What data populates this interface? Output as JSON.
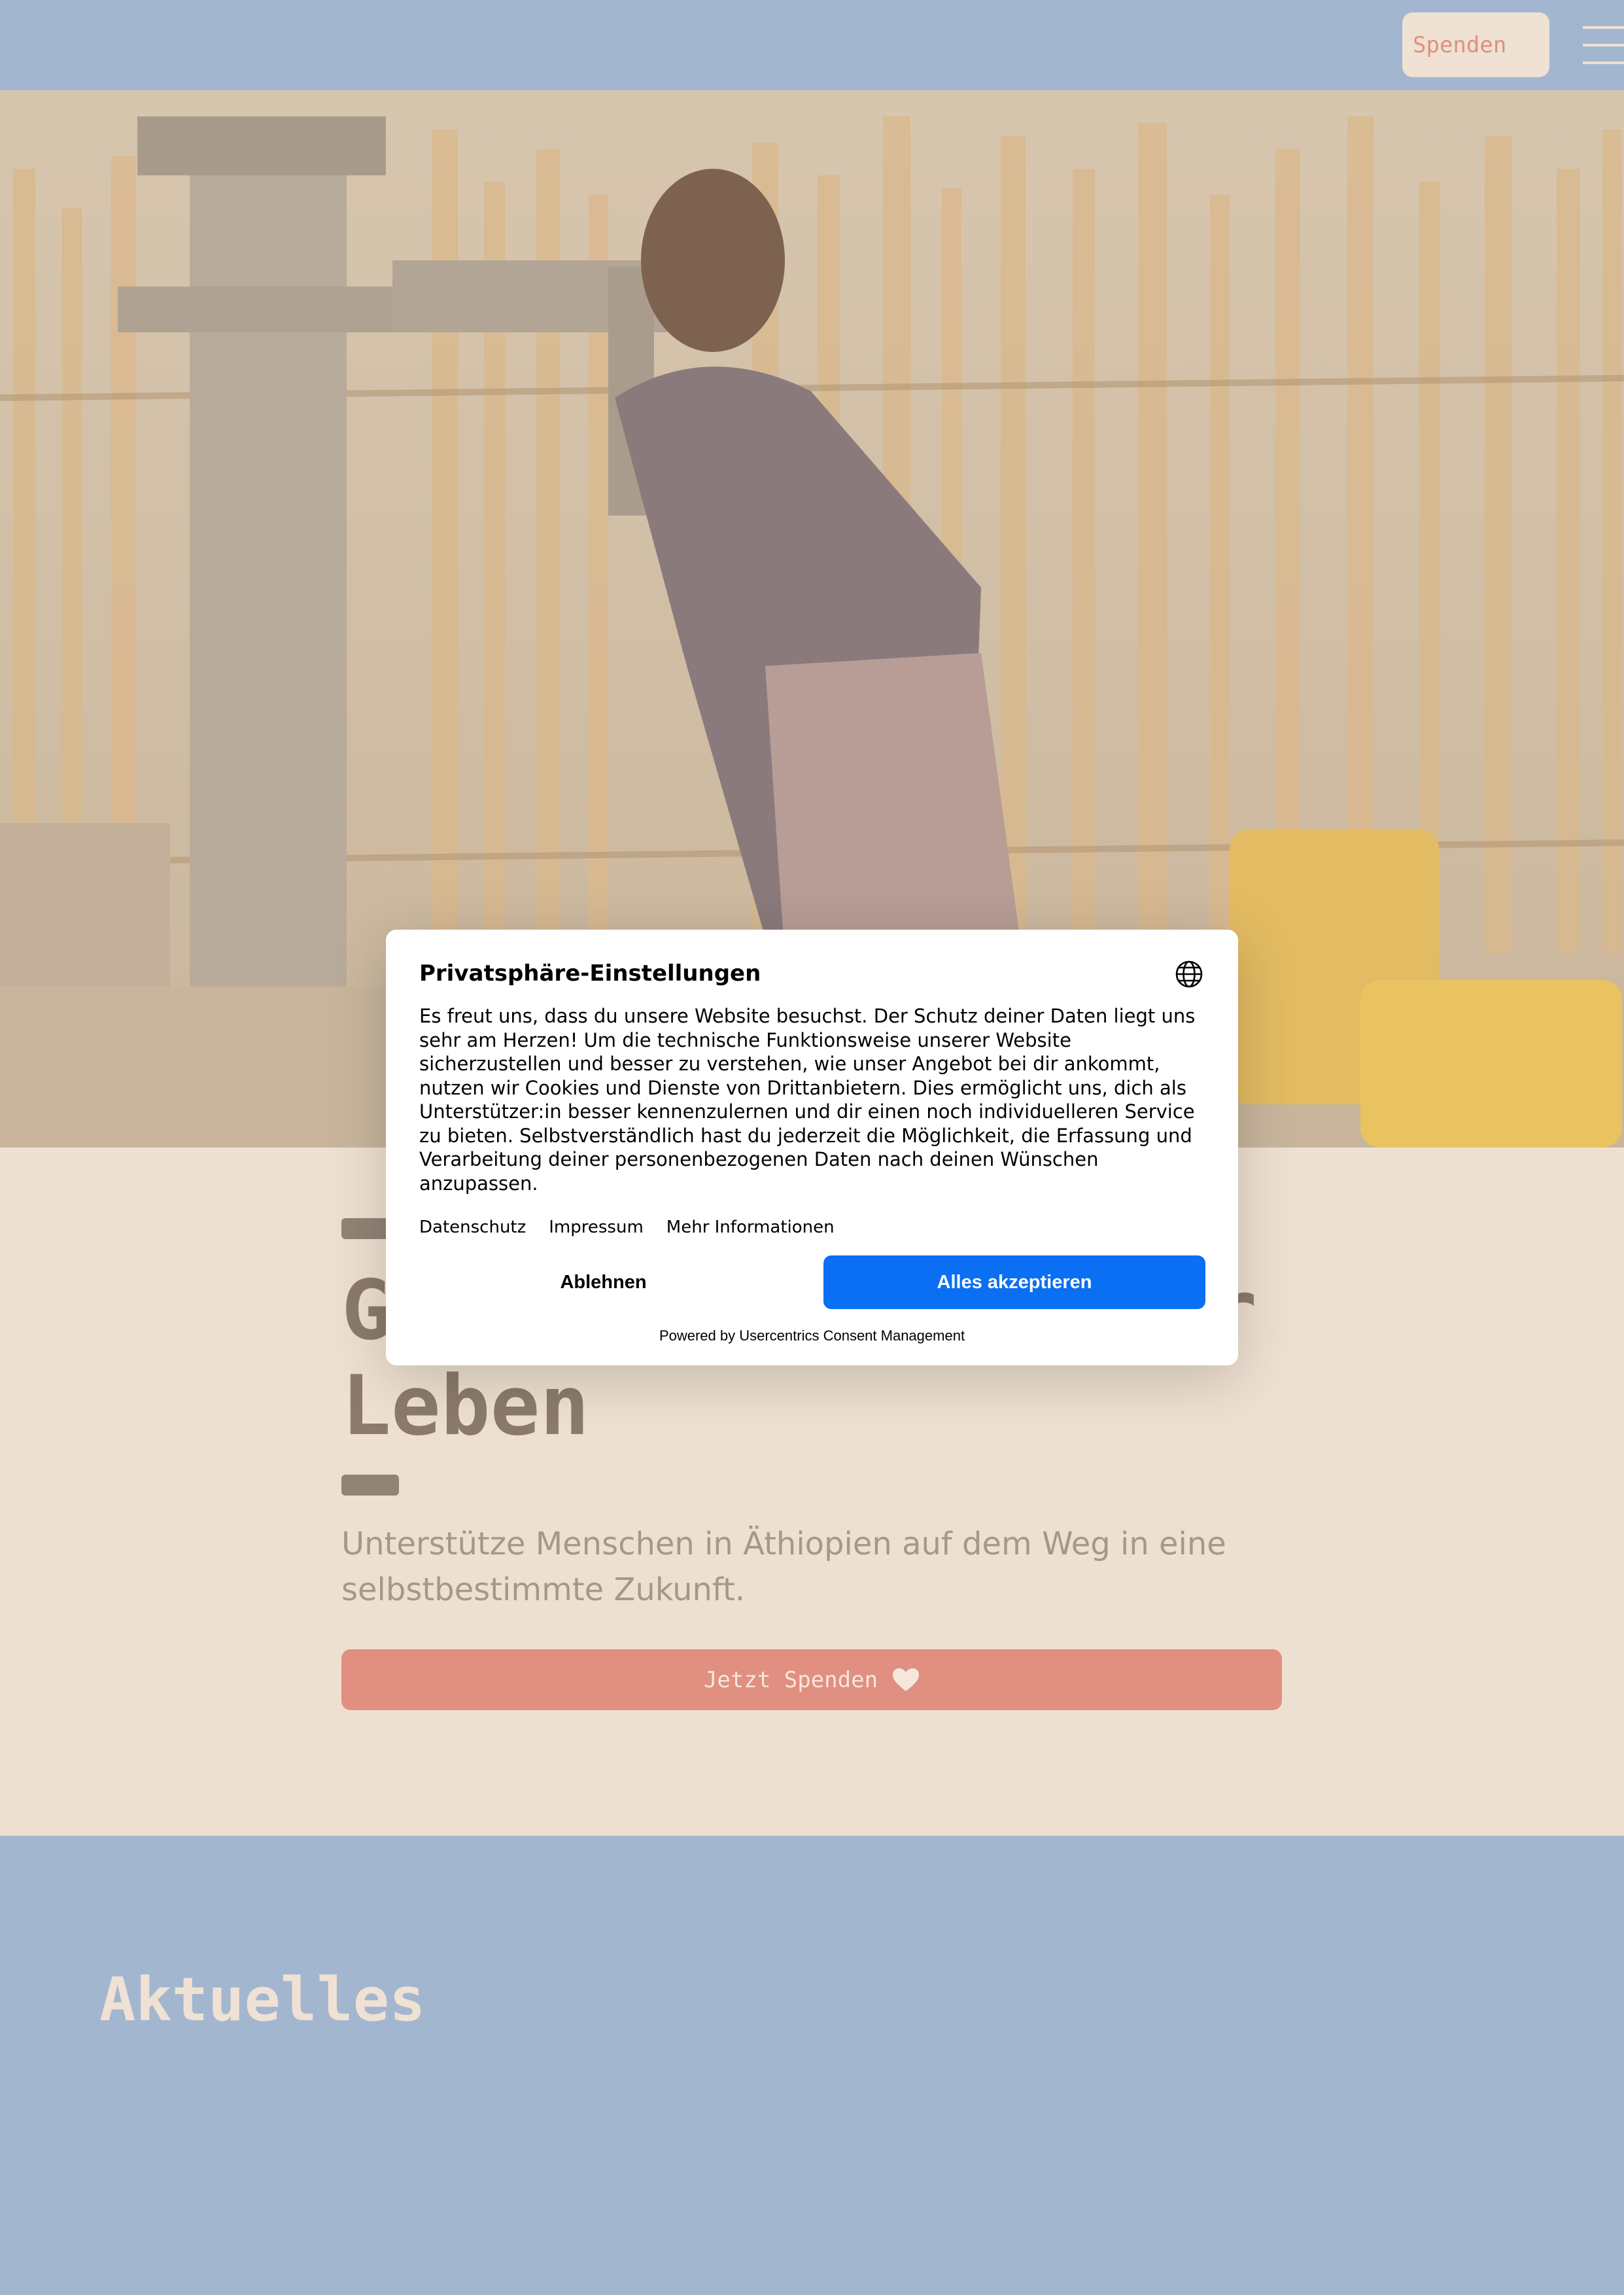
{
  "header": {
    "donate_label": "Spenden"
  },
  "hero": {
    "title_line1": "G",
    "title_line1_end": "r",
    "title_line2": "Leben",
    "subtitle": "Unterstütze Menschen in Äthiopien auf dem Weg in eine selbstbestimmte Zukunft.",
    "cta_label": "Jetzt Spenden"
  },
  "news": {
    "title": "Aktuelles"
  },
  "consent": {
    "title": "Privatsphäre-Einstellungen",
    "body": "Es freut uns, dass du unsere Website besuchst. Der Schutz deiner Daten liegt uns sehr am Herzen! Um die technische Funktionsweise unserer Website sicherzustellen und besser zu verstehen, wie unser Angebot bei dir ankommt, nutzen wir Cookies und Dienste von Drittanbietern. Dies ermöglicht uns, dich als Unterstützer:in besser kennenzulernen und dir einen noch individuelleren Service zu bieten. Selbstverständlich hast du jederzeit die Möglichkeit, die Erfassung und Verarbeitung deiner personenbezogenen Daten nach deinen Wünschen anzupassen.",
    "links": [
      "Datenschutz",
      "Impressum",
      "Mehr Informationen"
    ],
    "decline_label": "Ablehnen",
    "accept_label": "Alles akzeptieren",
    "powered_by": "Powered by Usercentrics Consent Management",
    "accent_color": "#0a6ff3"
  },
  "icons": {
    "globe": "globe-icon",
    "heart": "heart-icon",
    "menu": "hamburger-menu-icon"
  }
}
